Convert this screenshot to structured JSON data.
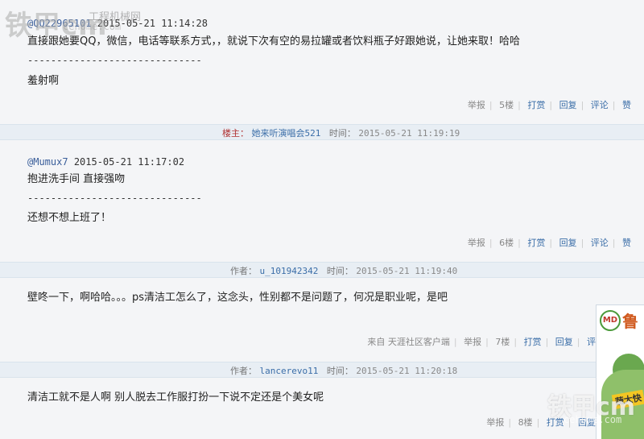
{
  "watermark": {
    "brand": "铁甲cm",
    "cn": "工程机械网",
    "url": "cehome.com"
  },
  "posts": [
    {
      "quote_user": "@QQ22965101",
      "quote_time": "2015-05-21 11:14:28",
      "quote_text": "直接跟她要QQ，微信，电话等联系方式，，就说下次有空的易拉罐或者饮料瓶子好跟她说，让她来取！哈哈",
      "dashes": "------------------------------",
      "reply": "羞射啊",
      "actions": {
        "report": "举报",
        "floor": "5楼",
        "tip": "打赏",
        "reply": "回复",
        "comment": "评论",
        "like": "赞"
      }
    },
    {
      "header": {
        "role": "楼主：",
        "name": "她来听演唱会521",
        "time_label": "时间：",
        "time": "2015-05-21 11:19:19"
      },
      "quote_user": "@Mumux7",
      "quote_time": "2015-05-21 11:17:02",
      "quote_text": "抱进洗手间 直接强吻",
      "dashes": "------------------------------",
      "reply": "还想不想上班了！",
      "actions": {
        "report": "举报",
        "floor": "6楼",
        "tip": "打赏",
        "reply": "回复",
        "comment": "评论",
        "like": "赞"
      }
    },
    {
      "header": {
        "role": "作者：",
        "name": "u_101942342",
        "time_label": "时间：",
        "time": "2015-05-21 11:19:40"
      },
      "reply": "壁咚一下，啊哈哈。。。ps清洁工怎么了，这念头，性别都不是问题了，何况是职业呢，是吧",
      "source": "来自 天涯社区客户端",
      "actions": {
        "report": "举报",
        "floor": "7楼",
        "tip": "打赏",
        "reply": "回复",
        "comment": "评"
      }
    },
    {
      "header": {
        "role": "作者：",
        "name": "lancerevo11",
        "time_label": "时间：",
        "time": "2015-05-21 11:20:18"
      },
      "reply": "清洁工就不是人啊 别人脱去工作服打扮一下说不定还是个美女呢",
      "actions": {
        "report": "举报",
        "floor": "8楼",
        "tip": "打赏",
        "reply": "回复"
      }
    }
  ],
  "ad": {
    "logo": "MD",
    "title": "鲁",
    "badge": "蔬大快"
  },
  "colors": {
    "link": "#3b6ea8",
    "owner": "#b03030",
    "divider_bg": "#e8eef4",
    "page_bg": "#f4f5f7"
  }
}
